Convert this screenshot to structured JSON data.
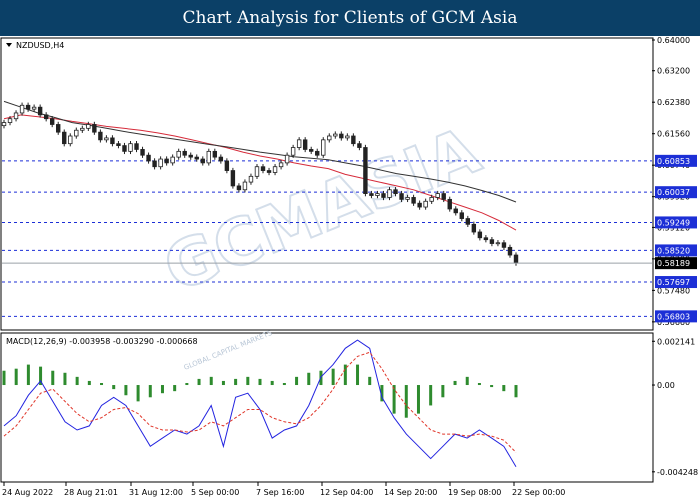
{
  "banner": {
    "title": "Chart Analysis for Clients of GCM Asia"
  },
  "watermark": {
    "text": "GCMASIA",
    "sub": "GLOBAL CAPITAL MARKETS"
  },
  "main_chart": {
    "symbol_label": "NZDUSD,H4"
  },
  "macd_panel": {
    "label": "MACD(12,26,9) -0.003958 -0.003290 -0.000668"
  },
  "colors": {
    "banner_bg": "#0b4067",
    "level_line": "#1c2fd6",
    "label_bg": "#1c2fd6",
    "macd_line": "#2324e0",
    "signal_line": "#e0362a",
    "histogram": "#2e8b2e",
    "ma_fast": "#d62b3a",
    "ma_slow": "#333333",
    "candle": "#222222"
  },
  "chart_data": [
    {
      "type": "candlestick",
      "title": "NZDUSD,H4",
      "ylim": [
        0.565,
        0.64
      ],
      "y_ticks": [
        "0.64000",
        "0.63200",
        "0.62380",
        "0.61560",
        "0.60740",
        "0.59920",
        "0.59120",
        "0.58300",
        "0.57480",
        "0.56660"
      ],
      "x_labels": [
        "24 Aug 2022",
        "28 Aug 21:01",
        "31 Aug 12:00",
        "5 Sep 00:00",
        "7 Sep 16:00",
        "12 Sep 04:00",
        "14 Sep 20:00",
        "19 Sep 08:00",
        "22 Sep 00:00"
      ],
      "horizontal_levels": [
        {
          "value": 0.60853,
          "label": "0.60853"
        },
        {
          "value": 0.60037,
          "label": "0.60037"
        },
        {
          "value": 0.59249,
          "label": "0.59249"
        },
        {
          "value": 0.5852,
          "label": "0.58520"
        },
        {
          "value": 0.57697,
          "label": "0.57697"
        },
        {
          "value": 0.56803,
          "label": "0.56803"
        }
      ],
      "current_price": {
        "value": 0.58189,
        "label": "0.58189"
      },
      "closes": [
        0.6185,
        0.6195,
        0.621,
        0.623,
        0.622,
        0.6225,
        0.6205,
        0.6195,
        0.618,
        0.616,
        0.613,
        0.615,
        0.6165,
        0.617,
        0.618,
        0.616,
        0.614,
        0.6145,
        0.613,
        0.6125,
        0.611,
        0.613,
        0.6115,
        0.61,
        0.6085,
        0.607,
        0.609,
        0.608,
        0.6095,
        0.611,
        0.61,
        0.6095,
        0.609,
        0.608,
        0.611,
        0.6095,
        0.6085,
        0.606,
        0.602,
        0.601,
        0.603,
        0.6045,
        0.607,
        0.606,
        0.6055,
        0.607,
        0.608,
        0.61,
        0.612,
        0.614,
        0.6115,
        0.611,
        0.61,
        0.614,
        0.615,
        0.6155,
        0.6145,
        0.615,
        0.613,
        0.612,
        0.6,
        0.5995,
        0.6,
        0.599,
        0.601,
        0.6,
        0.5985,
        0.599,
        0.5975,
        0.5965,
        0.598,
        0.599,
        0.6,
        0.5985,
        0.596,
        0.595,
        0.5935,
        0.592,
        0.59,
        0.5885,
        0.588,
        0.587,
        0.5872,
        0.586,
        0.584,
        0.5819
      ],
      "series": [
        {
          "name": "ma_fast",
          "values": [
            0.6195,
            0.6205,
            0.62,
            0.6195,
            0.6188,
            0.6182,
            0.6175,
            0.617,
            0.6165,
            0.6158,
            0.615,
            0.614,
            0.613,
            0.612,
            0.6108,
            0.6098,
            0.609,
            0.608,
            0.6072,
            0.6065,
            0.605,
            0.604,
            0.603,
            0.602,
            0.601,
            0.5995,
            0.598,
            0.5965,
            0.595,
            0.593,
            0.5905
          ]
        },
        {
          "name": "ma_slow",
          "values": [
            0.624,
            0.6225,
            0.621,
            0.6198,
            0.6185,
            0.6178,
            0.617,
            0.6162,
            0.6155,
            0.6148,
            0.6142,
            0.6135,
            0.6128,
            0.6122,
            0.6115,
            0.6108,
            0.6102,
            0.6096,
            0.6092,
            0.6088,
            0.608,
            0.6072,
            0.6062,
            0.6052,
            0.6045,
            0.6038,
            0.603,
            0.602,
            0.6008,
            0.5995,
            0.5978
          ]
        }
      ]
    },
    {
      "type": "line",
      "title": "MACD(12,26,9) -0.003958 -0.003290 -0.000668",
      "ylim": [
        -0.0046,
        0.0024
      ],
      "y_ticks": [
        "0.002141",
        "0.00",
        "-0.004248"
      ],
      "series": [
        {
          "name": "MACD",
          "values": [
            -0.002,
            -0.0015,
            -0.0005,
            0.0002,
            -0.0008,
            -0.0018,
            -0.0022,
            -0.002,
            -0.001,
            -0.0006,
            -0.001,
            -0.002,
            -0.003,
            -0.0026,
            -0.0022,
            -0.0024,
            -0.002,
            -0.001,
            -0.003,
            -0.0006,
            -0.0004,
            -0.0012,
            -0.0026,
            -0.0022,
            -0.002,
            -0.001,
            0.0004,
            0.001,
            0.0018,
            0.0022,
            0.0018,
            -0.0006,
            -0.0016,
            -0.0024,
            -0.003,
            -0.0036,
            -0.003,
            -0.0024,
            -0.0026,
            -0.0022,
            -0.0026,
            -0.003,
            -0.004
          ]
        },
        {
          "name": "Signal",
          "values": [
            -0.0025,
            -0.002,
            -0.0012,
            -0.0004,
            -0.0002,
            -0.0008,
            -0.0014,
            -0.0018,
            -0.0016,
            -0.0012,
            -0.0011,
            -0.0014,
            -0.002,
            -0.0022,
            -0.0022,
            -0.0023,
            -0.0022,
            -0.0018,
            -0.002,
            -0.0016,
            -0.0012,
            -0.0012,
            -0.0016,
            -0.0018,
            -0.0019,
            -0.0016,
            -0.001,
            -0.0002,
            0.0008,
            0.0014,
            0.0016,
            0.0008,
            -0.0002,
            -0.001,
            -0.0016,
            -0.0022,
            -0.0024,
            -0.0024,
            -0.0025,
            -0.0024,
            -0.0025,
            -0.0027,
            -0.0033
          ]
        },
        {
          "name": "Histogram",
          "values": [
            0.0007,
            0.0008,
            0.001,
            0.0009,
            0.0007,
            0.0006,
            0.0004,
            0.0002,
            0.0001,
            -0.0002,
            -0.0005,
            -0.0008,
            -0.0006,
            -0.0004,
            -0.0003,
            0.0001,
            0.0003,
            0.0004,
            0.0002,
            0.0003,
            0.0004,
            0.0003,
            0.0002,
            0.0001,
            0.0004,
            0.0006,
            0.0007,
            0.0008,
            0.001,
            0.001,
            0.0004,
            -0.0008,
            -0.0014,
            -0.0016,
            -0.0014,
            -0.001,
            -0.0006,
            0.0002,
            0.0004,
            0.0001,
            -0.0001,
            -0.0003,
            -0.0006
          ]
        }
      ]
    }
  ]
}
